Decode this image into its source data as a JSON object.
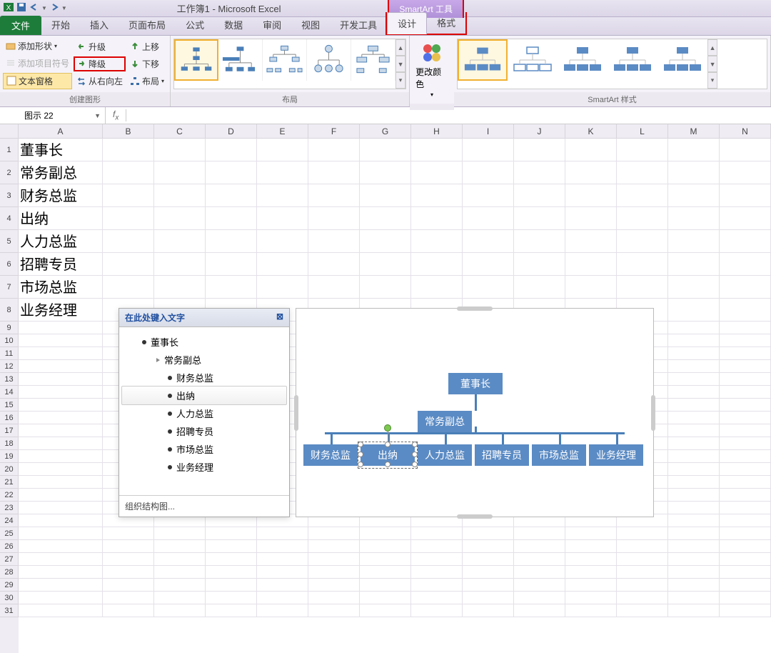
{
  "app": {
    "title": "工作簿1 - Microsoft Excel",
    "contextTab": "SmartArt 工具"
  },
  "tabs": {
    "file": "文件",
    "home": "开始",
    "insert": "插入",
    "pageLayout": "页面布局",
    "formulas": "公式",
    "data": "数据",
    "review": "审阅",
    "view": "视图",
    "developer": "开发工具",
    "design": "设计",
    "format": "格式"
  },
  "ribbon": {
    "createGraphic": {
      "label": "创建图形",
      "addShape": "添加形状",
      "addBullet": "添加项目符号",
      "textPane": "文本窗格",
      "promote": "升级",
      "demote": "降级",
      "rtl": "从右向左",
      "moveUp": "上移",
      "moveDown": "下移",
      "layoutBtn": "布局"
    },
    "layouts": {
      "label": "布局"
    },
    "changeColors": "更改颜色",
    "styles": {
      "label": "SmartArt 样式"
    }
  },
  "nameBox": "图示 22",
  "columns": [
    "A",
    "B",
    "C",
    "D",
    "E",
    "F",
    "G",
    "H",
    "I",
    "J",
    "K",
    "L",
    "M",
    "N"
  ],
  "cellData": [
    "董事长",
    "常务副总",
    "财务总监",
    "出纳",
    "人力总监",
    "招聘专员",
    "市场总监",
    "业务经理"
  ],
  "textPane": {
    "title": "在此处键入文字",
    "items": [
      {
        "text": "董事长",
        "level": 0,
        "bullet": "dot"
      },
      {
        "text": "常务副总",
        "level": 1,
        "bullet": "arrow"
      },
      {
        "text": "财务总监",
        "level": 2,
        "bullet": "dot"
      },
      {
        "text": "出纳",
        "level": 2,
        "bullet": "dot",
        "selected": true
      },
      {
        "text": "人力总监",
        "level": 2,
        "bullet": "dot"
      },
      {
        "text": "招聘专员",
        "level": 2,
        "bullet": "dot"
      },
      {
        "text": "市场总监",
        "level": 2,
        "bullet": "dot"
      },
      {
        "text": "业务经理",
        "level": 2,
        "bullet": "dot"
      }
    ],
    "footer": "组织结构图..."
  },
  "org": {
    "top": "董事长",
    "mid": "常务副总",
    "leaves": [
      "财务总监",
      "出纳",
      "人力总监",
      "招聘专员",
      "市场总监",
      "业务经理"
    ],
    "selectedLeaf": 1
  }
}
